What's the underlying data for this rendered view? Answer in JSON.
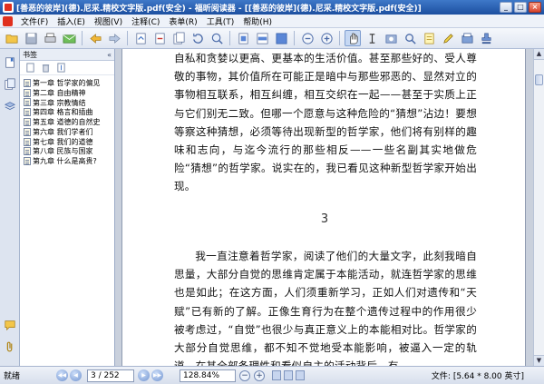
{
  "window": {
    "title": "[善恶的彼岸](德).尼采.精校文字版.pdf(安全) - 福昕阅读器 - [[善恶的彼岸](德).尼采.精校文字版.pdf(安全)]",
    "minimize": "_",
    "maximize": "□",
    "close": "×"
  },
  "menu": [
    "文件(F)",
    "插入(E)",
    "视图(V)",
    "注释(C)",
    "表单(R)",
    "工具(T)",
    "帮助(H)"
  ],
  "sidebar": {
    "header": "书签",
    "collapse": "«",
    "bookmarks": [
      "第一章 哲学家的偏见",
      "第二章 自由精神",
      "第三章 宗教情结",
      "第四章 格言和插曲",
      "第五章 道德的自然史",
      "第六章 我们学者们",
      "第七章 我们的道德",
      "第八章 民族与国家",
      "第九章 什么是高贵?"
    ]
  },
  "document": {
    "upper_paragraph": "自私和贪婪以更高、更基本的生活价值。甚至那些好的、受人尊敬的事物，其价值所在可能正是暗中与那些邪恶的、显然对立的事物相互联系，相互纠缠，相互交织在一起——甚至于实质上正与它们别无二致。但哪一个愿意与这种危险的“猜想”沾边！要想等察这种猜想，必须等待出现新型的哲学家，他们将有别样的趣味和志向，与迄今流行的那些相反——一些名副其实地做危险“猜想”的哲学家。说实在的，我已看见这种新型哲学家开始出现。",
    "page_number": "3",
    "lower_paragraph": "我一直注意着哲学家，阅读了他们的大量文字，此刻我暗自思量，大部分自觉的思维肯定属于本能活动，就连哲学家的思维也是如此；在这方面，人们须重新学习，正如人们对遗传和“天赋”已有新的了解。正像生育行为在整个遗传过程中的作用很少被考虑过，“自觉”也很少与真正意义上的本能相对比。哲学家的大部分自觉思维，都不知不觉地受本能影响，被逼入一定的轨道。在其全部条理性和看似自主的活动背后，有"
  },
  "status": {
    "ready": "就绪",
    "page_value": "3 / 252",
    "zoom_value": "128.84%",
    "file_size": "文件: [5.64 * 8.00 英寸]"
  },
  "colors": {
    "titlebar": "#1d4fa0",
    "page_background": "#ffffff",
    "workspace": "#c9d0dc"
  }
}
